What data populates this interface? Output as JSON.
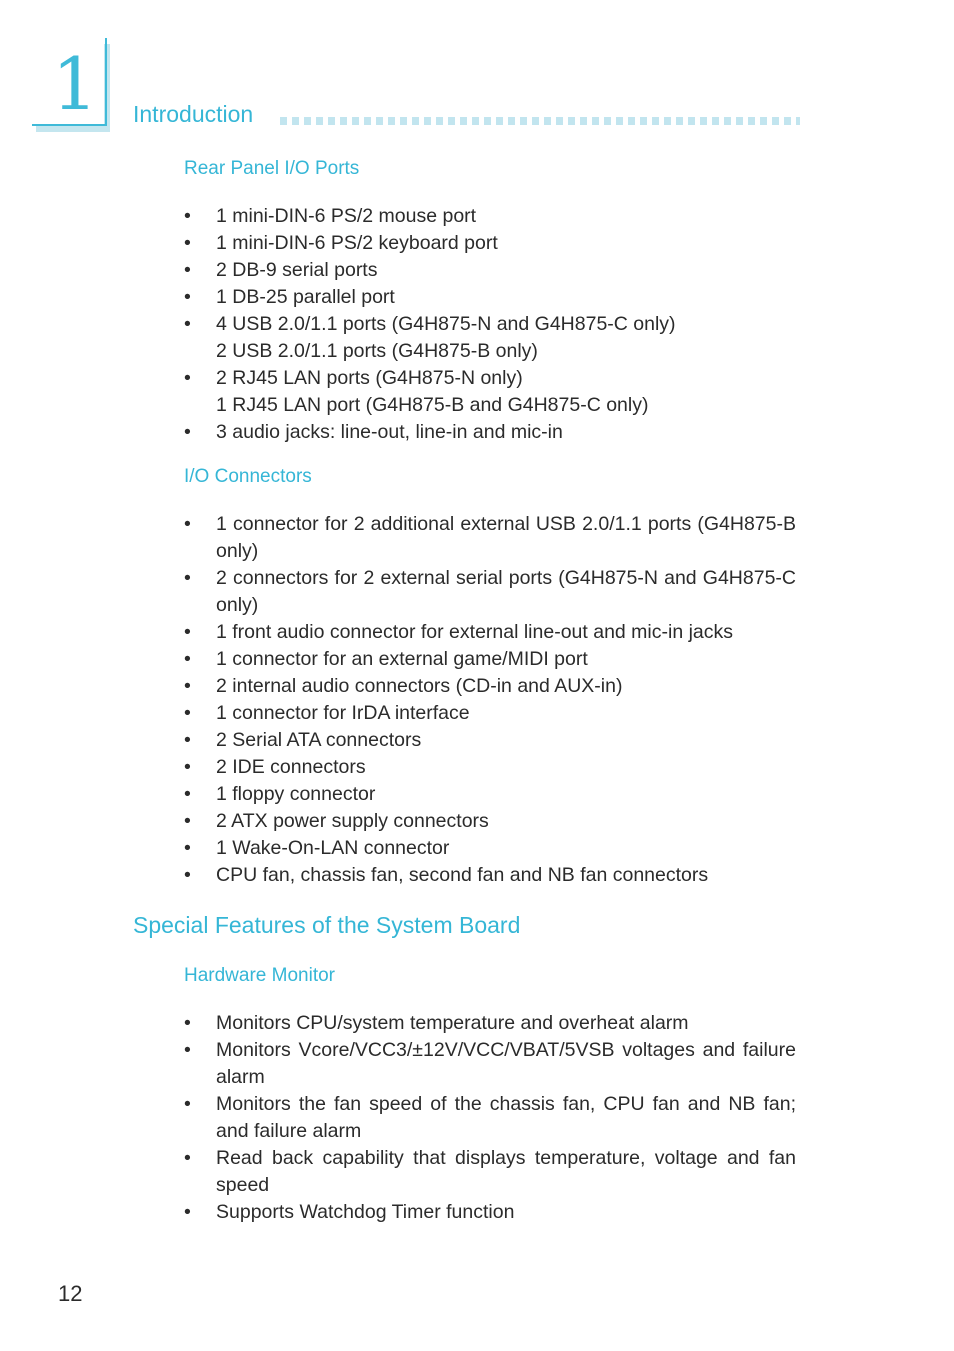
{
  "chapter": {
    "number": "1",
    "title": "Introduction"
  },
  "sections": {
    "rear_panel": {
      "title": "Rear Panel I/O Ports",
      "items": [
        "1 mini-DIN-6 PS/2 mouse port",
        "1 mini-DIN-6 PS/2 keyboard port",
        "2 DB-9 serial ports",
        "1 DB-25 parallel port",
        [
          "4 USB 2.0/1.1 ports (G4H875-N and G4H875-C only)",
          "2 USB 2.0/1.1 ports (G4H875-B only)"
        ],
        [
          "2 RJ45 LAN ports (G4H875-N only)",
          "1 RJ45 LAN port (G4H875-B and G4H875-C only)"
        ],
        "3 audio jacks: line-out, line-in and mic-in"
      ]
    },
    "io_connectors": {
      "title": "I/O Connectors",
      "items": [
        "1 connector for 2 additional external USB 2.0/1.1 ports (G4H875-B only)",
        "2 connectors for 2 external serial ports (G4H875-N and G4H875-C only)",
        "1 front audio connector for external line-out and mic-in jacks",
        "1 connector for an external game/MIDI port",
        "2 internal audio connectors (CD-in and AUX-in)",
        "1 connector for IrDA interface",
        "2 Serial ATA connectors",
        "2 IDE connectors",
        "1 floppy connector",
        "2 ATX power supply connectors",
        "1 Wake-On-LAN connector",
        "CPU fan, chassis fan, second fan and NB fan connectors"
      ]
    },
    "special_features": {
      "title": "Special Features of the System Board",
      "hardware_monitor": {
        "title": "Hardware Monitor",
        "items": [
          "Monitors CPU/system temperature and overheat alarm",
          "Monitors Vcore/VCC3/±12V/VCC/VBAT/5VSB voltages and failure alarm",
          "Monitors the fan speed of the chassis fan, CPU fan and NB fan; and failure alarm",
          "Read back capability that displays temperature, voltage and fan speed",
          "Supports Watchdog Timer function"
        ]
      }
    }
  },
  "bullet_glyph": "•",
  "page_number": "12",
  "colors": {
    "accent": "#35b6d6",
    "accent_light": "#c2e5ef",
    "text": "#2b2b2b"
  }
}
